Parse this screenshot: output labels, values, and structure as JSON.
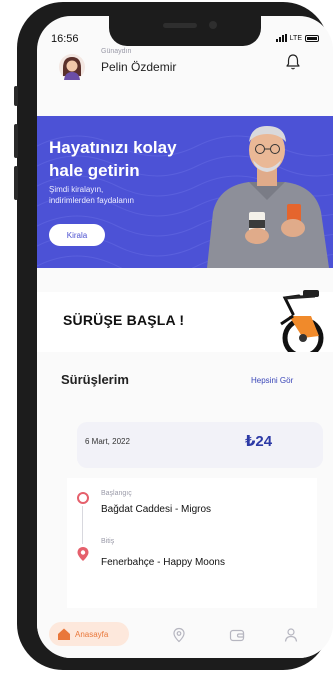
{
  "status_bar": {
    "time": "16:56",
    "network": "LTE"
  },
  "header": {
    "greeting": "Günaydın",
    "username": "Pelin Özdemir"
  },
  "banner": {
    "title_line1": "Hayatınızı kolay",
    "title_line2": "hale getirin",
    "subtitle_line1": "Şimdi kiralayın,",
    "subtitle_line2": "indirimlerden faydalanın",
    "button_label": "Kirala"
  },
  "start_ride": {
    "label": "SÜRÜŞE BAŞLA !"
  },
  "rides": {
    "title": "Sürüşlerim",
    "see_all_label": "Hepsini Gör",
    "items": [
      {
        "date": "6 Mart, 2022",
        "price": "₺24",
        "origin_label": "Başlangıç",
        "origin": "Bağdat Caddesi - Migros",
        "destination_label": "Bitiş",
        "destination": "Fenerbahçe - Happy Moons"
      }
    ]
  },
  "bottom_nav": {
    "home_label": "Anasayfa",
    "items": [
      "home-icon",
      "location-icon",
      "wallet-icon",
      "profile-icon"
    ]
  },
  "colors": {
    "banner_bg": "#4c52d6",
    "accent_orange": "#e9773a",
    "price_blue": "#2d3aa6",
    "origin_red": "#e5606c"
  }
}
